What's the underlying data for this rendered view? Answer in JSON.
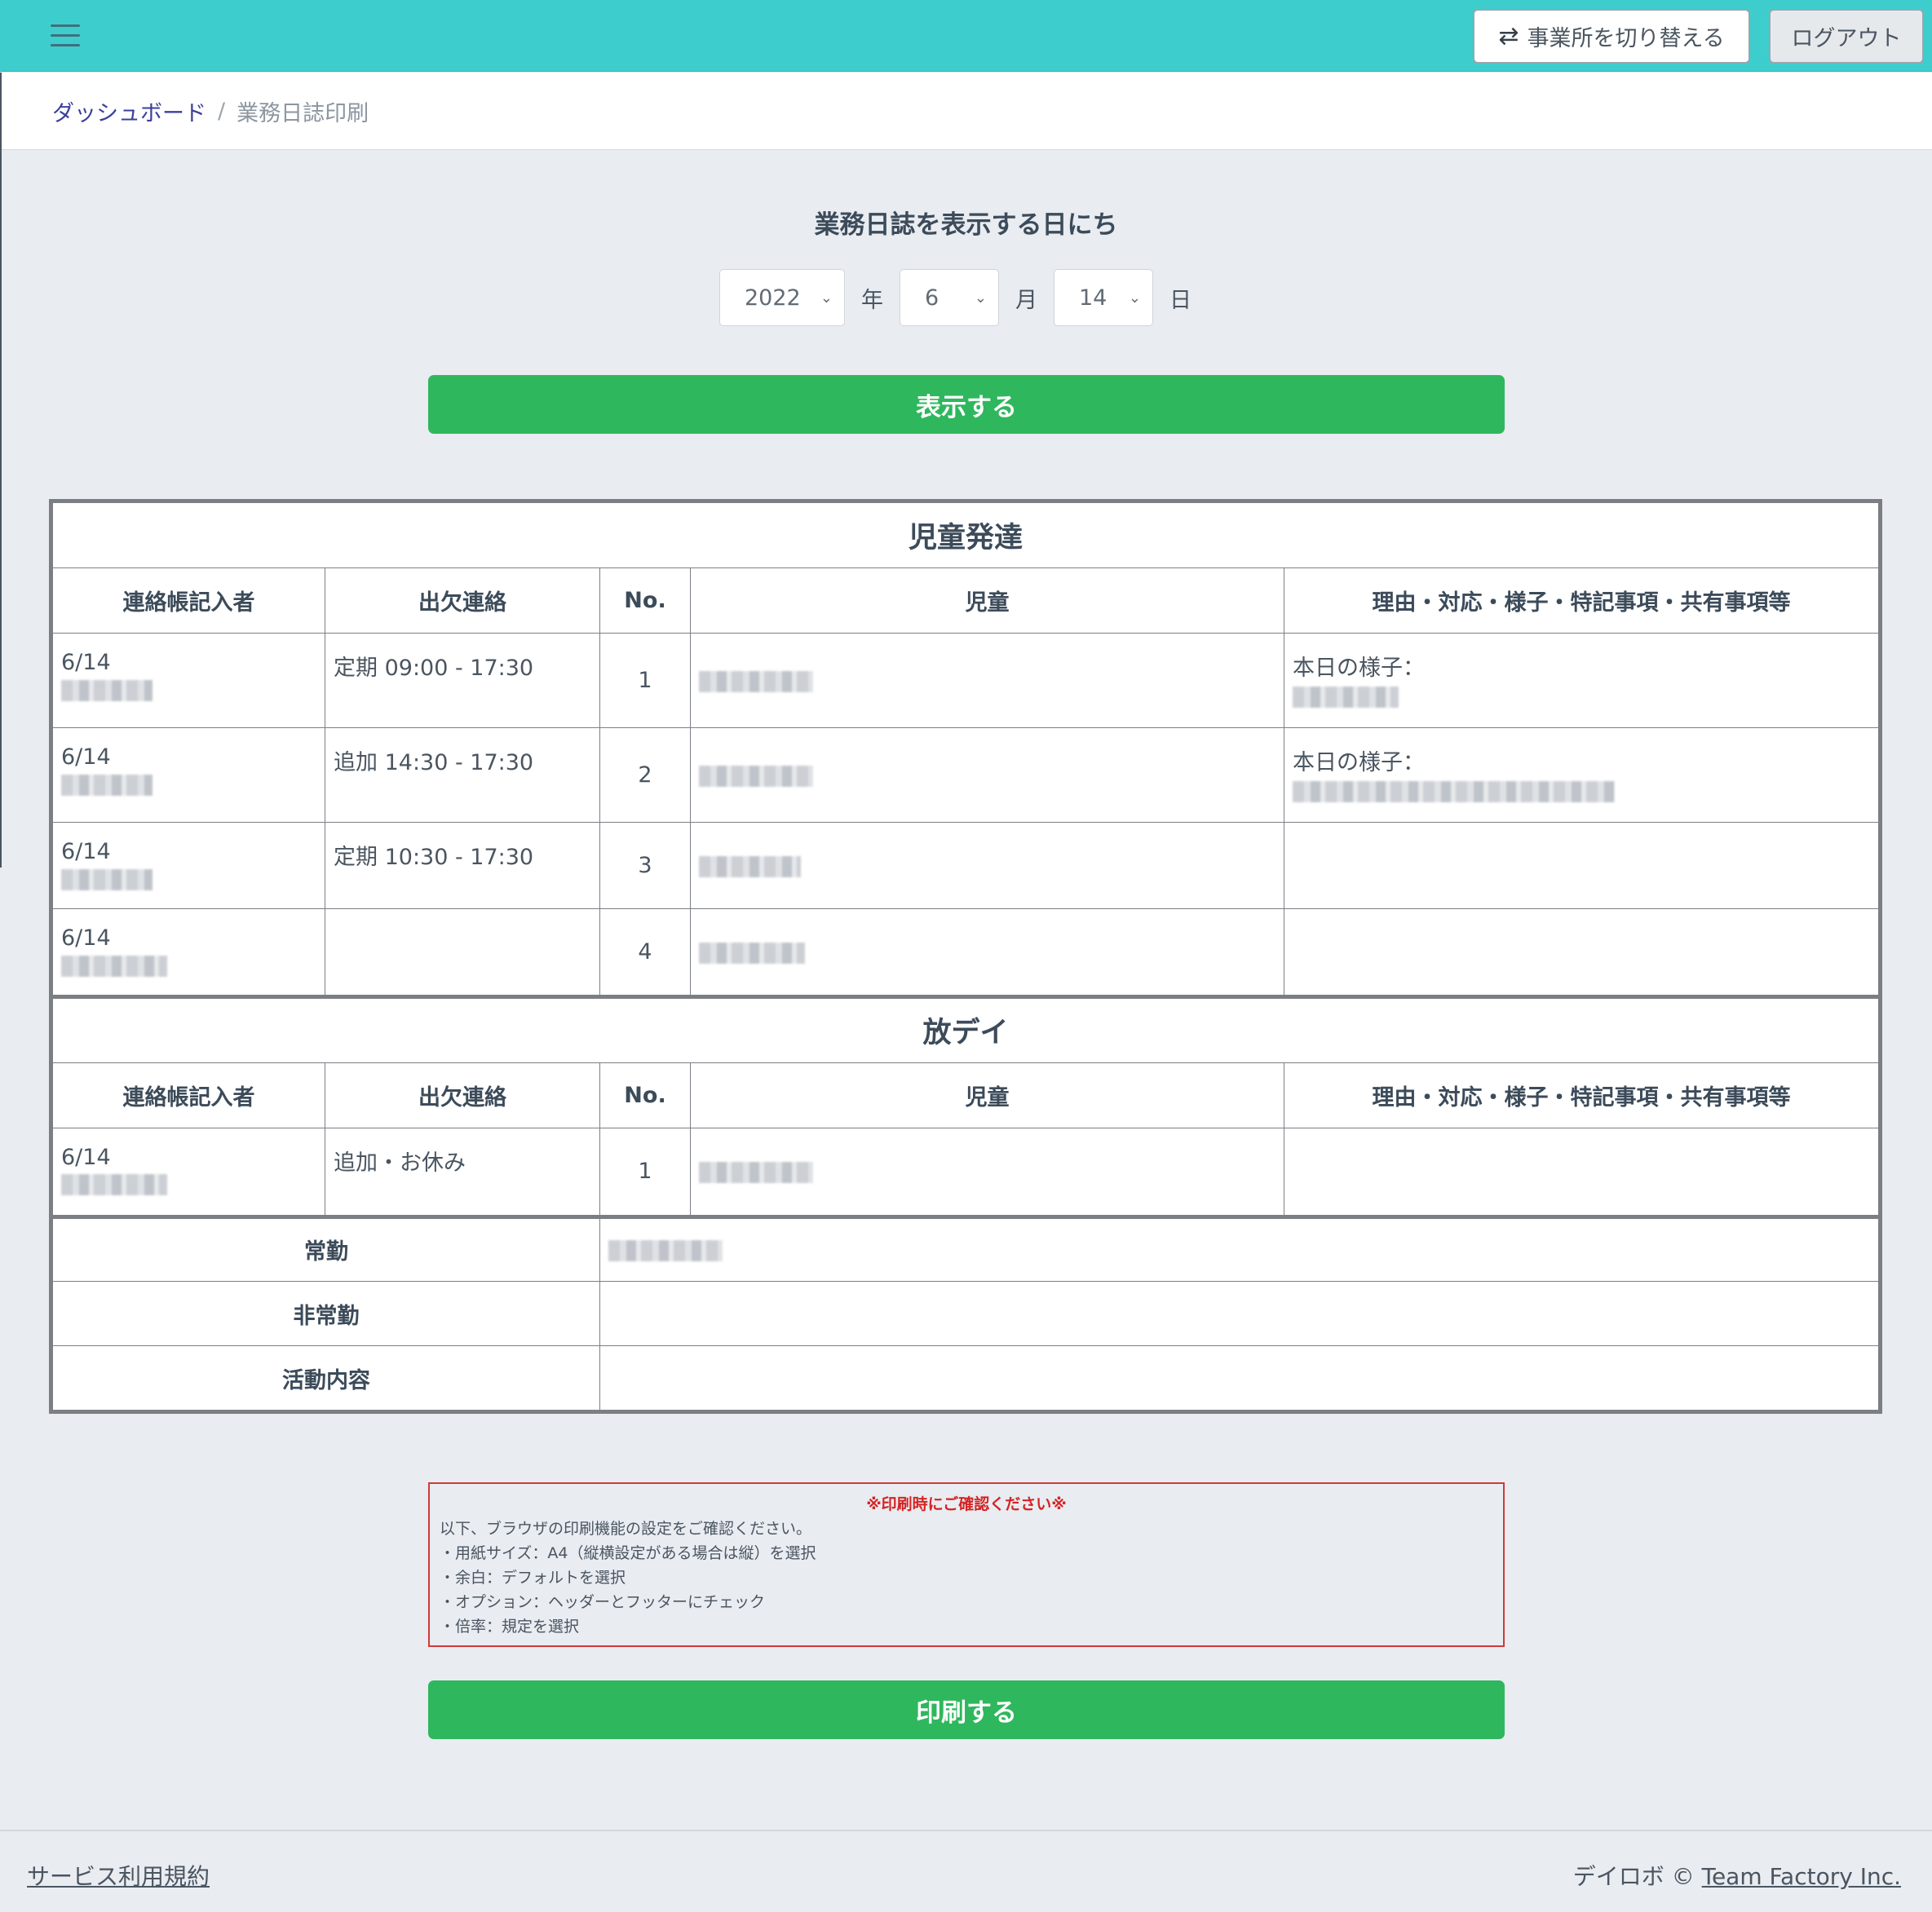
{
  "header": {
    "switch_label": "事業所を切り替える",
    "switch_icon": "⇄",
    "logout_label": "ログアウト",
    "bg_color": "#3ecdcd"
  },
  "breadcrumb": {
    "home": "ダッシュボード",
    "separator": "/",
    "current": "業務日誌印刷"
  },
  "date_picker": {
    "title": "業務日誌を表示する日にち",
    "year": "2022",
    "year_unit": "年",
    "month": "6",
    "month_unit": "月",
    "day": "14",
    "day_unit": "日",
    "show_button": "表示する"
  },
  "report": {
    "columns": [
      "連絡帳記入者",
      "出欠連絡",
      "No.",
      "児童",
      "理由・対応・様子・特記事項・共有事項等"
    ],
    "sections": [
      {
        "title": "児童発達",
        "rows": [
          {
            "date": "6/14",
            "attendance": "定期 09:00 - 17:30",
            "no": "1",
            "note": "本日の様子："
          },
          {
            "date": "6/14",
            "attendance": "追加 14:30 - 17:30",
            "no": "2",
            "note": "本日の様子："
          },
          {
            "date": "6/14",
            "attendance": "定期 10:30 - 17:30",
            "no": "3",
            "note": ""
          },
          {
            "date": "6/14",
            "attendance": "",
            "no": "4",
            "note": ""
          }
        ]
      },
      {
        "title": "放デイ",
        "rows": [
          {
            "date": "6/14",
            "attendance": "追加・お休み",
            "no": "1",
            "note": ""
          }
        ]
      }
    ],
    "staff": {
      "fulltime_label": "常勤",
      "parttime_label": "非常勤",
      "activity_label": "活動内容"
    }
  },
  "notice": {
    "title": "※印刷時にご確認ください※",
    "intro": "以下、ブラウザの印刷機能の設定をご確認ください。",
    "items": [
      "・用紙サイズ：A4（縦横設定がある場合は縦）を選択",
      "・余白：デフォルトを選択",
      "・オプション：ヘッダーとフッターにチェック",
      "・倍率：規定を選択"
    ]
  },
  "print_button": "印刷する",
  "footer": {
    "terms": "サービス利用規約",
    "copyright_prefix": "デイロボ ©",
    "company": "Team Factory Inc."
  }
}
